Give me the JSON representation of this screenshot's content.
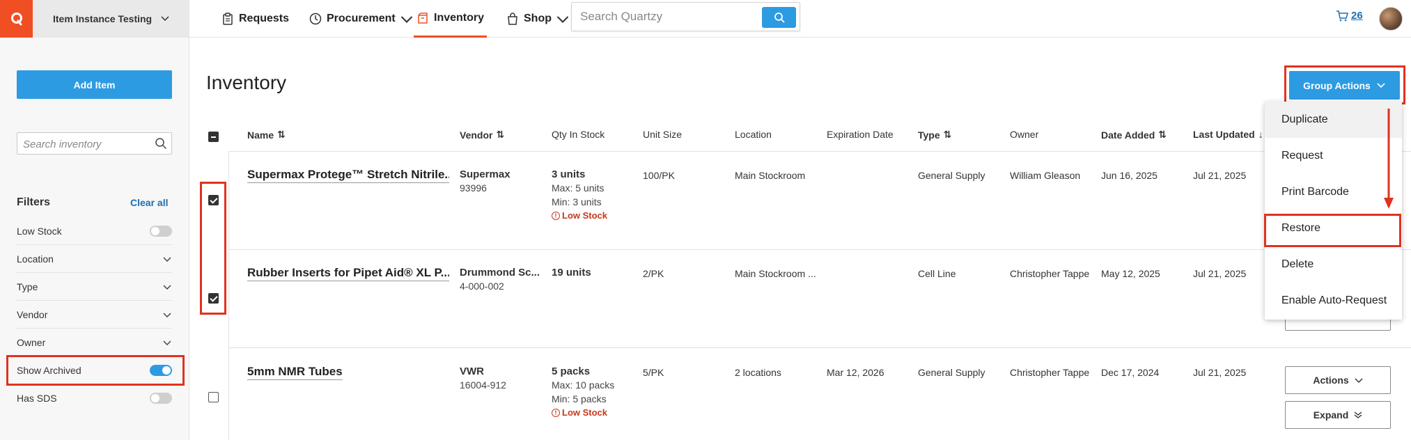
{
  "header": {
    "logo": "quartzy-logo",
    "org_name": "Item Instance Testing",
    "nav": [
      {
        "label": "Requests",
        "icon": "clipboard-icon"
      },
      {
        "label": "Procurement",
        "icon": "clock-dollar-icon"
      },
      {
        "label": "Inventory",
        "icon": "box-icon",
        "active": true
      },
      {
        "label": "Shop",
        "icon": "bag-icon"
      }
    ],
    "search_placeholder": "Search Quartzy",
    "cart_count": "26"
  },
  "sidebar": {
    "add_item_label": "Add Item",
    "search_placeholder": "Search inventory",
    "filters_title": "Filters",
    "clear_all": "Clear all",
    "filters": [
      {
        "label": "Low Stock",
        "control": "toggle",
        "on": false
      },
      {
        "label": "Location",
        "control": "chevron"
      },
      {
        "label": "Type",
        "control": "chevron"
      },
      {
        "label": "Vendor",
        "control": "chevron"
      },
      {
        "label": "Owner",
        "control": "chevron"
      },
      {
        "label": "Show Archived",
        "control": "toggle",
        "on": true
      },
      {
        "label": "Has SDS",
        "control": "toggle",
        "on": false
      }
    ]
  },
  "main": {
    "title": "Inventory",
    "group_actions_label": "Group Actions",
    "columns": [
      "Name",
      "Vendor",
      "Qty In Stock",
      "Unit Size",
      "Location",
      "Expiration Date",
      "Type",
      "Owner",
      "Date Added",
      "Last Updated"
    ],
    "rows": [
      {
        "checked": true,
        "name": "Supermax Protege™ Stretch Nitrile...",
        "vendor": "Supermax",
        "catalog": "93996",
        "qty": "3 units",
        "max": "Max: 5 units",
        "min": "Min: 3 units",
        "low_stock": "Low Stock",
        "unit_size": "100/PK",
        "location": "Main Stockroom",
        "expiration": "",
        "type": "General Supply",
        "owner": "William Gleason",
        "date_added": "Jun 16, 2025",
        "last_updated": "Jul 21, 2025"
      },
      {
        "checked": true,
        "name": "Rubber Inserts for Pipet Aid® XL P...",
        "vendor": "Drummond Sc...",
        "catalog": "4-000-002",
        "qty": "19 units",
        "max": "",
        "min": "",
        "low_stock": "",
        "unit_size": "2/PK",
        "location": "Main Stockroom ...",
        "expiration": "",
        "type": "Cell Line",
        "owner": "Christopher Tappe",
        "date_added": "May 12, 2025",
        "last_updated": "Jul 21, 2025"
      },
      {
        "checked": false,
        "name": "5mm NMR Tubes",
        "vendor": "VWR",
        "catalog": "16004-912",
        "qty": "5 packs",
        "max": "Max: 10 packs",
        "min": "Min: 5 packs",
        "low_stock": "Low Stock",
        "unit_size": "5/PK",
        "location": "2 locations",
        "expiration": "Mar 12, 2026",
        "type": "General Supply",
        "owner": "Christopher Tappe",
        "date_added": "Dec 17, 2024",
        "last_updated": "Jul 21, 2025"
      }
    ],
    "row_actions_label": "Actions",
    "row_expand_label": "Expand",
    "group_actions_menu": [
      "Duplicate",
      "Request",
      "Print Barcode",
      "Restore",
      "Delete",
      "Enable Auto-Request"
    ]
  },
  "colors": {
    "brand_orange": "#f04e23",
    "primary_blue": "#2d9be2",
    "highlight_red": "#e0321f",
    "low_stock_red": "#c9361b"
  }
}
